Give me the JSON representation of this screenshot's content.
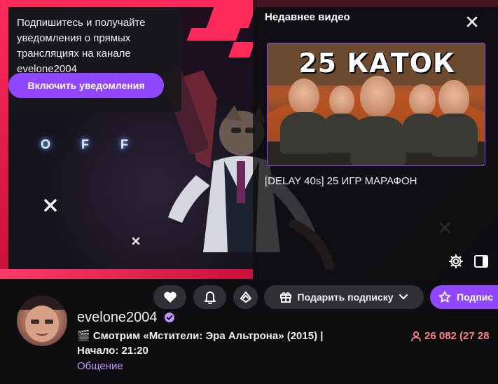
{
  "player": {
    "offline_letters": [
      "O",
      "F",
      "F"
    ]
  },
  "notify": {
    "text": "Подпишитесь и получайте уведомления о прямых трансляциях на канале evelone2004",
    "button_label": "Включить уведомления"
  },
  "recent": {
    "header": "Недавнее видео",
    "thumbnail_text": "25 КАТОК",
    "video_title": "[DELAY 40s] 25 ИГР МАРАФОН"
  },
  "actions": {
    "gift_label": "Подарить подписку",
    "subscribe_label": "Подпис"
  },
  "channel": {
    "name": "evelone2004",
    "title_line1": "🎬 Смотрим «Мстители: Эра Альтрона» (2015) |",
    "title_line2": "Начало: 21:20",
    "category": "Общение",
    "viewers": "26 082 (27 28"
  },
  "colors": {
    "accent": "#9147ff",
    "brand_pink": "#ff2a5a",
    "viewer_red": "#ff8280",
    "category_purple": "#bf94ff"
  }
}
